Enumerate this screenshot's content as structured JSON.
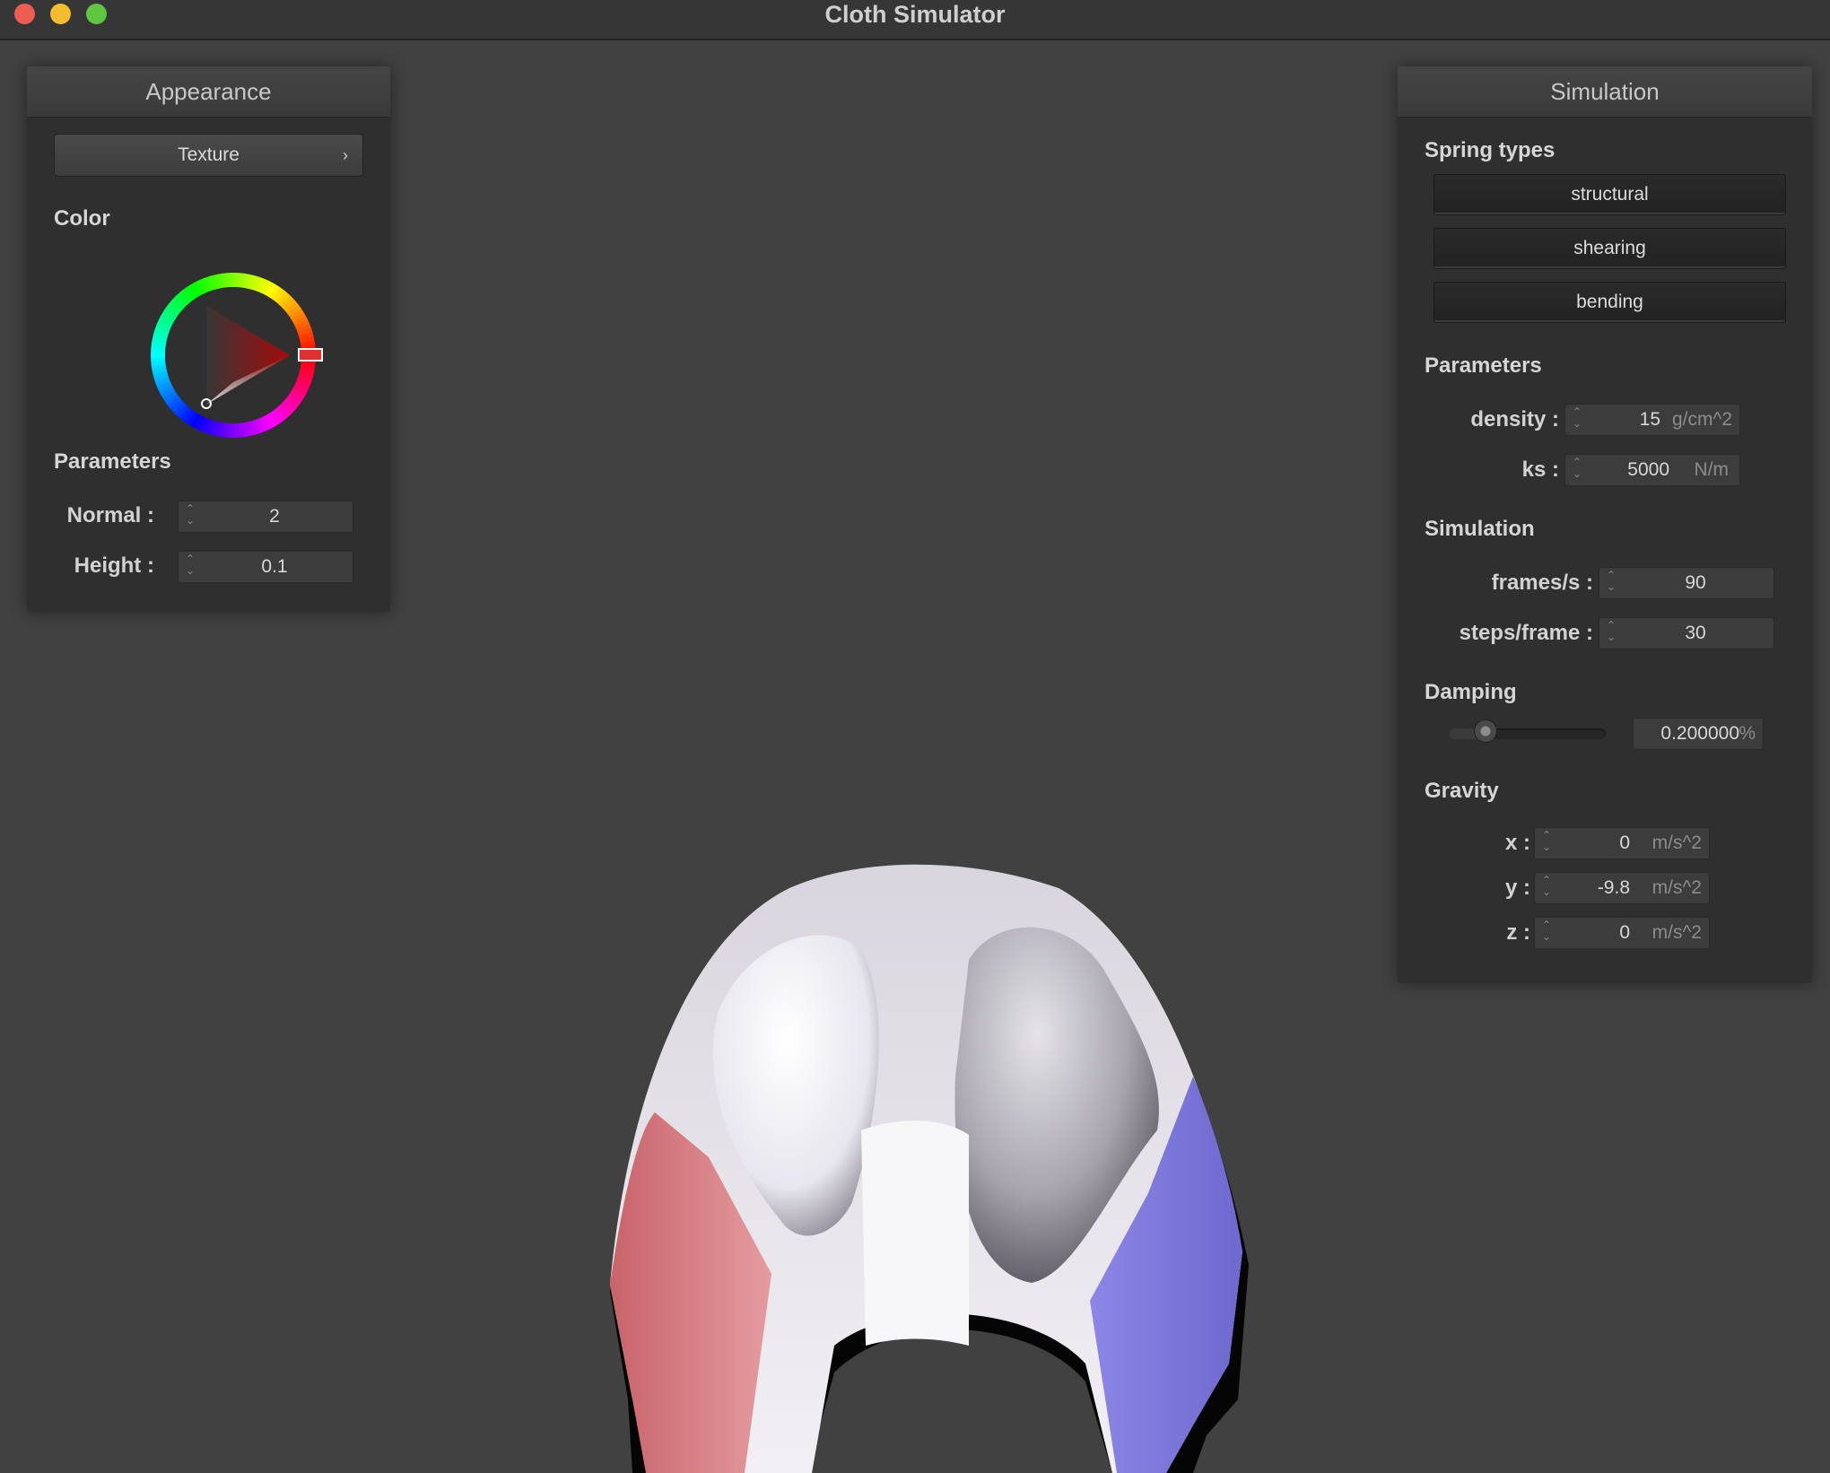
{
  "window": {
    "title": "Cloth Simulator"
  },
  "appearance": {
    "title": "Appearance",
    "texture_label": "Texture",
    "color_label": "Color",
    "selected_color": "#ff0000",
    "parameters_label": "Parameters",
    "normal": {
      "label": "Normal :",
      "value": "2"
    },
    "height": {
      "label": "Height :",
      "value": "0.1"
    }
  },
  "simulation": {
    "title": "Simulation",
    "spring_types_label": "Spring types",
    "springs": [
      "structural",
      "shearing",
      "bending"
    ],
    "parameters_label": "Parameters",
    "density": {
      "label": "density :",
      "value": "15",
      "unit": "g/cm^2"
    },
    "ks": {
      "label": "ks :",
      "value": "5000",
      "unit": "N/m"
    },
    "simulation_label": "Simulation",
    "fps": {
      "label": "frames/s :",
      "value": "90"
    },
    "steps": {
      "label": "steps/frame :",
      "value": "30"
    },
    "damping_label": "Damping",
    "damping": {
      "value": "0.200000",
      "unit": "%",
      "slider_fraction": 0.2
    },
    "gravity_label": "Gravity",
    "gravity": {
      "x": {
        "label": "x :",
        "value": "0",
        "unit": "m/s^2"
      },
      "y": {
        "label": "y :",
        "value": "-9.8",
        "unit": "m/s^2"
      },
      "z": {
        "label": "z :",
        "value": "0",
        "unit": "m/s^2"
      }
    }
  },
  "colors": {
    "background": "#414141",
    "panel": "#2f2f2f",
    "cloth_left": "#d86f72",
    "cloth_right": "#7e78de",
    "cloth_mid": "#e9e6ec"
  }
}
